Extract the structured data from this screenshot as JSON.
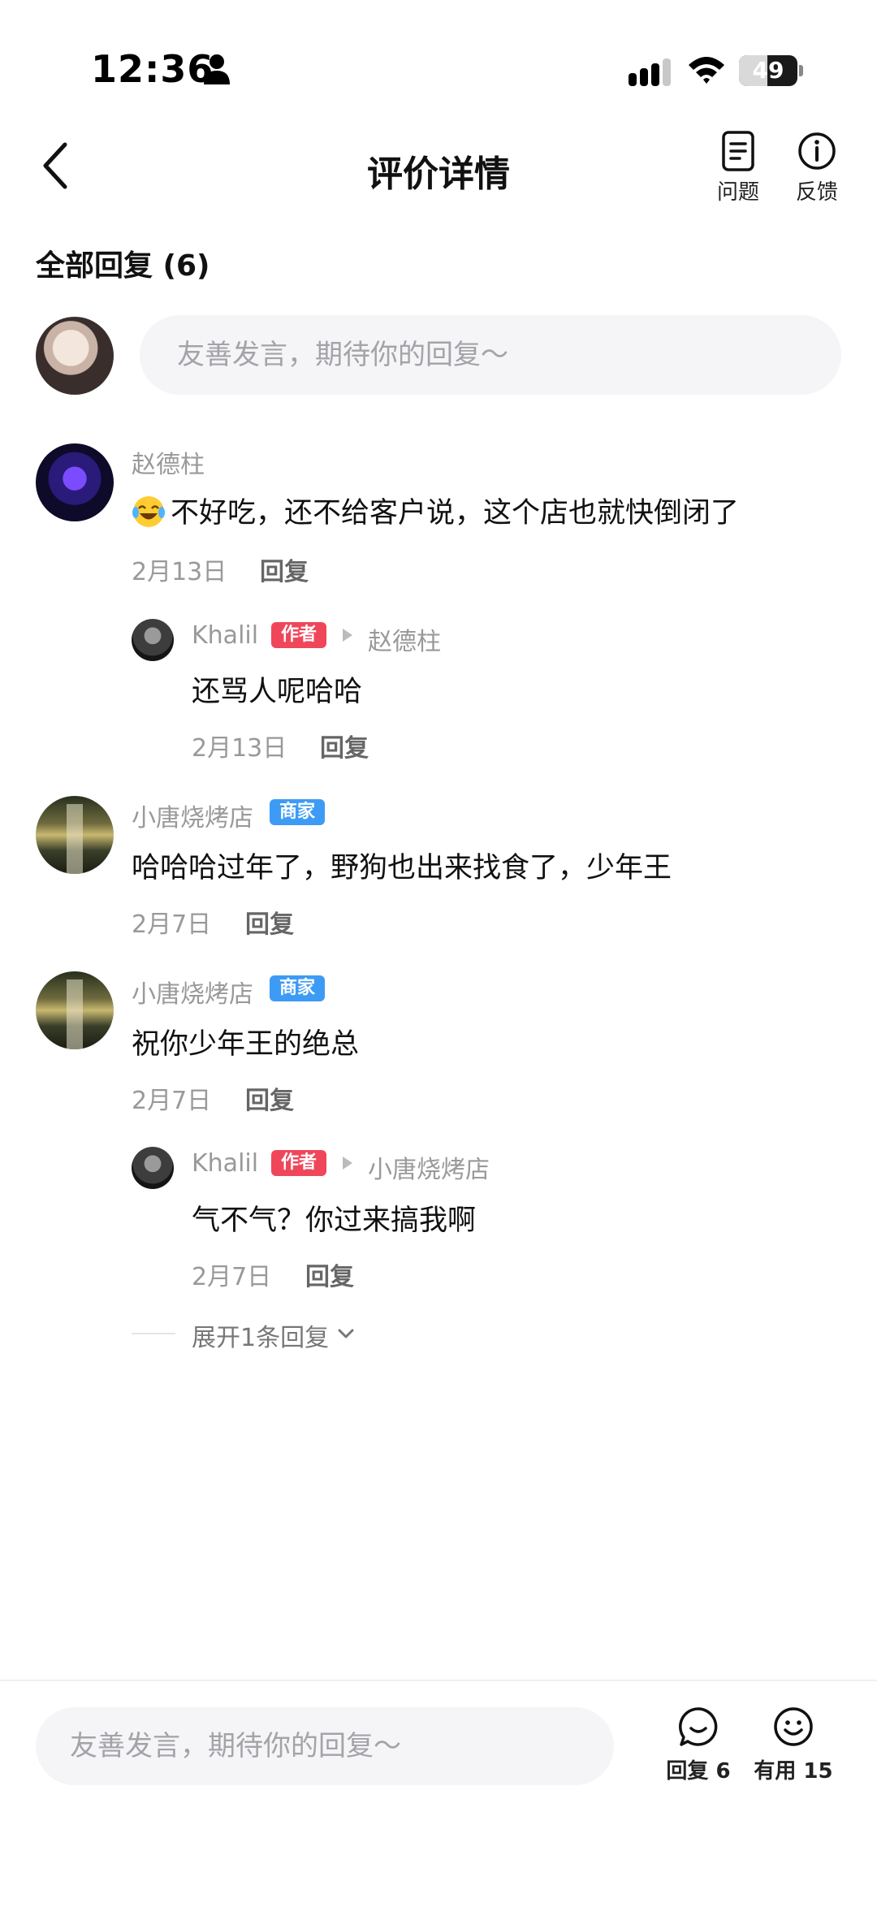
{
  "status_bar": {
    "time": "12:36",
    "battery": "49",
    "battery_level": 0.49
  },
  "header": {
    "title": "评价详情",
    "question_label": "问题",
    "feedback_label": "反馈"
  },
  "section": {
    "title": "全部回复 (6)"
  },
  "top_input": {
    "placeholder": "友善发言，期待你的回复～"
  },
  "comments": [
    {
      "name": "赵德柱",
      "text": "不好吃，还不给客户说，这个店也就快倒闭了",
      "emoji": "laughing-crying",
      "date": "2月13日",
      "reply": "回复"
    },
    {
      "name": "Khalil",
      "badge": "作者",
      "reply_to": "赵德柱",
      "text": "还骂人呢哈哈",
      "date": "2月13日",
      "reply": "回复"
    },
    {
      "name": "小唐烧烤店",
      "badge": "商家",
      "text": "哈哈哈过年了，野狗也出来找食了，少年王",
      "date": "2月7日",
      "reply": "回复"
    },
    {
      "name": "小唐烧烤店",
      "badge": "商家",
      "text": "祝你少年王的绝总",
      "date": "2月7日",
      "reply": "回复"
    },
    {
      "name": "Khalil",
      "badge": "作者",
      "reply_to": "小唐烧烤店",
      "text": "气不气？你过来搞我啊",
      "date": "2月7日",
      "reply": "回复"
    }
  ],
  "expand": {
    "label": "展开1条回复"
  },
  "bottom_bar": {
    "placeholder": "友善发言，期待你的回复～",
    "reply_label": "回复 6",
    "useful_label": "有用 15"
  },
  "colors": {
    "author_badge": "#f0465a",
    "merchant_badge": "#3d9bf5"
  }
}
